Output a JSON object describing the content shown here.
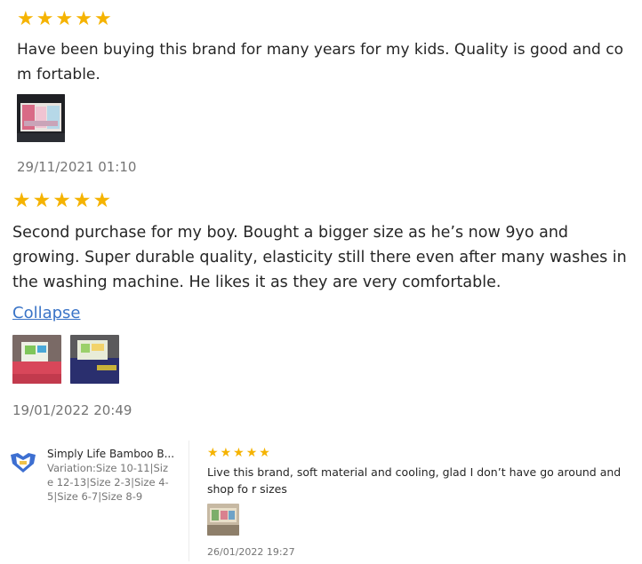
{
  "colors": {
    "star": "#f5b301",
    "link": "#3a74c7",
    "muted_text": "#757575",
    "body_text": "#262626"
  },
  "reviews": [
    {
      "rating": 5,
      "text": "Have been buying this brand for many years for my kids. Quality is good and com fortable.",
      "timestamp": "29/11/2021 01:10"
    },
    {
      "rating": 5,
      "text": "Second purchase for my boy. Bought a bigger size as he’s now 9yo and growing. Super durable quality, elasticity still there even after many washes in the washing machine. He likes it as they are very comfortable.",
      "collapse_label": "Collapse",
      "timestamp": "19/01/2022 20:49"
    },
    {
      "rating": 5,
      "text": "Live this brand, soft material and cooling, glad I don’t have go around and shop fo r sizes",
      "timestamp": "26/01/2022 19:27"
    }
  ],
  "product": {
    "name": "Simply Life Bamboo B...",
    "icon": "product-thumbnail-icon",
    "variation": "Variation:Size 10-11|Size 12-13|Size 2-3|Size 4-5|Size 6-7|Size 8-9"
  }
}
